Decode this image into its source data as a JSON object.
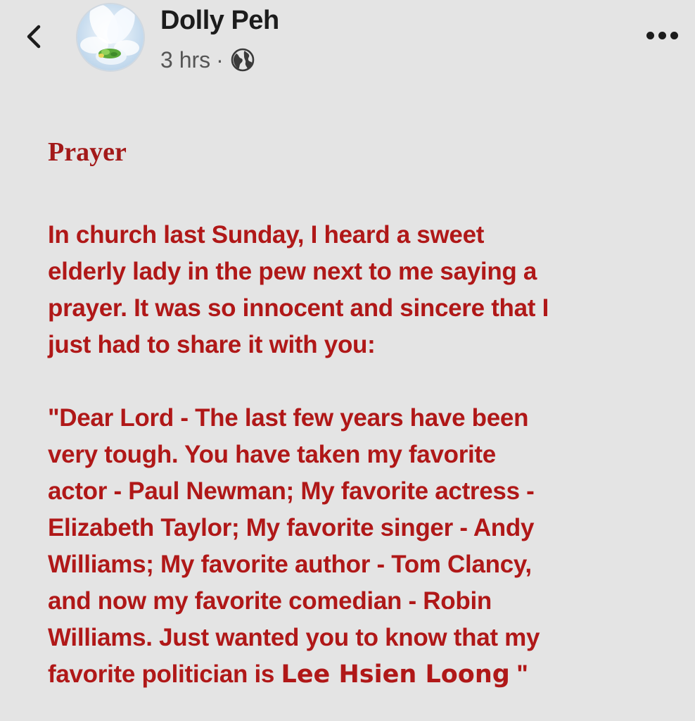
{
  "header": {
    "author_name": "Dolly Peh",
    "timestamp": "3 hrs",
    "separator": "·",
    "back_icon": "chevron-left-icon",
    "privacy_icon": "globe-icon",
    "more_icon": "more-horizontal-icon"
  },
  "post": {
    "title": "Prayer",
    "paragraph1_lines": [
      "In church last Sunday, I heard a sweet",
      "elderly lady in the pew next to me saying a",
      "prayer. It was so innocent and sincere that I",
      "just had to share it with you:"
    ],
    "paragraph2_lines": [
      "\"Dear Lord - The last few years have been",
      "very tough.  You have taken my favorite",
      "actor - Paul Newman; My favorite actress -",
      "Elizabeth Taylor; My favorite singer - Andy",
      "Williams; My favorite author - Tom Clancy,",
      "and now my favorite comedian - Robin",
      "Williams.  Just wanted you to know that my"
    ],
    "last_line_prefix": "favorite politician is ",
    "last_line_name": "Lee Hsien Loong",
    "last_line_suffix": " \""
  },
  "colors": {
    "background": "#e4e4e4",
    "title_red": "#a31919",
    "body_red": "#b01818",
    "name_text": "#1c1c1c",
    "meta_text": "#555555"
  }
}
